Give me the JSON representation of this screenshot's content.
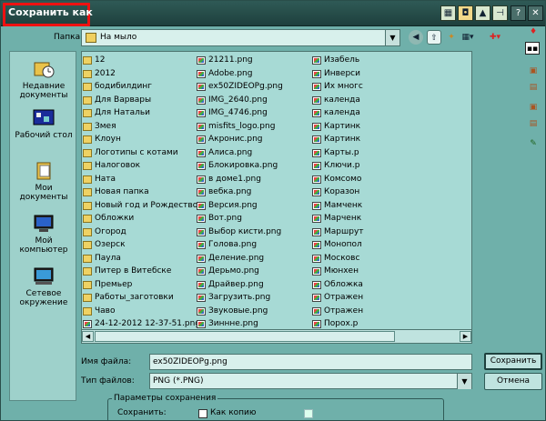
{
  "window": {
    "title": "Сохранить как"
  },
  "toolbar": {
    "folder_label": "Папка:",
    "folder_value": "На мыло"
  },
  "places": [
    {
      "label": "Недавние документы",
      "icon": "recent-docs-icon"
    },
    {
      "label": "Рабочий стол",
      "icon": "desktop-icon"
    },
    {
      "label": "Мои документы",
      "icon": "my-documents-icon"
    },
    {
      "label": "Мой компьютер",
      "icon": "my-computer-icon"
    },
    {
      "label": "Сетевое окружение",
      "icon": "network-icon"
    }
  ],
  "files": {
    "col1": [
      {
        "n": "12",
        "t": "folder"
      },
      {
        "n": "2012",
        "t": "folder"
      },
      {
        "n": "бодибилдинг",
        "t": "folder"
      },
      {
        "n": "Для Варвары",
        "t": "folder"
      },
      {
        "n": "Для Натальи",
        "t": "folder"
      },
      {
        "n": "Змея",
        "t": "folder"
      },
      {
        "n": "Клоун",
        "t": "folder"
      },
      {
        "n": "Логотипы с котами",
        "t": "folder"
      },
      {
        "n": "Налоговок",
        "t": "folder"
      },
      {
        "n": "Ната",
        "t": "folder"
      },
      {
        "n": "Новая папка",
        "t": "folder"
      },
      {
        "n": "Новый год и Рождество",
        "t": "folder"
      },
      {
        "n": "Обложки",
        "t": "folder"
      },
      {
        "n": "Огород",
        "t": "folder"
      },
      {
        "n": "Озерск",
        "t": "folder"
      },
      {
        "n": "Паула",
        "t": "folder"
      },
      {
        "n": "Питер в Витебске",
        "t": "folder"
      },
      {
        "n": "Премьер",
        "t": "folder"
      },
      {
        "n": "Работы_заготовки",
        "t": "folder"
      },
      {
        "n": "Чаво",
        "t": "folder"
      },
      {
        "n": "24-12-2012 12-37-51.png",
        "t": "img"
      }
    ],
    "col2": [
      {
        "n": "21211.png",
        "t": "img"
      },
      {
        "n": "Adobe.png",
        "t": "img"
      },
      {
        "n": "ex50ZIDEOPg.png",
        "t": "img"
      },
      {
        "n": "IMG_2640.png",
        "t": "img"
      },
      {
        "n": "IMG_4746.png",
        "t": "img"
      },
      {
        "n": "misfits_logo.png",
        "t": "img"
      },
      {
        "n": "Акронис.png",
        "t": "img"
      },
      {
        "n": "Алиса.png",
        "t": "img"
      },
      {
        "n": "Блокировка.png",
        "t": "img"
      },
      {
        "n": "в доме1.png",
        "t": "img"
      },
      {
        "n": "вебка.png",
        "t": "img"
      },
      {
        "n": "Версия.png",
        "t": "img"
      },
      {
        "n": "Вот.png",
        "t": "img"
      },
      {
        "n": "Выбор кисти.png",
        "t": "img"
      },
      {
        "n": "Голова.png",
        "t": "img"
      },
      {
        "n": "Деление.png",
        "t": "img"
      },
      {
        "n": "Дерьмо.png",
        "t": "img"
      },
      {
        "n": "Драйвер.png",
        "t": "img"
      },
      {
        "n": "Загрузить.png",
        "t": "img"
      },
      {
        "n": "Звуковые.png",
        "t": "img"
      },
      {
        "n": "Зиннне.png",
        "t": "img"
      }
    ],
    "col3": [
      {
        "n": "Изабель",
        "t": "img"
      },
      {
        "n": "Инверси",
        "t": "img"
      },
      {
        "n": "Их многс",
        "t": "img"
      },
      {
        "n": "календа",
        "t": "img"
      },
      {
        "n": "календа",
        "t": "img"
      },
      {
        "n": "Картинк",
        "t": "img"
      },
      {
        "n": "Картинк",
        "t": "img"
      },
      {
        "n": "Карты.p",
        "t": "img"
      },
      {
        "n": "Ключи.p",
        "t": "img"
      },
      {
        "n": "Комсомо",
        "t": "img"
      },
      {
        "n": "Коразон",
        "t": "img"
      },
      {
        "n": "Мамченк",
        "t": "img"
      },
      {
        "n": "Марченк",
        "t": "img"
      },
      {
        "n": "Маршрут",
        "t": "img"
      },
      {
        "n": "Монопол",
        "t": "img"
      },
      {
        "n": "Московс",
        "t": "img"
      },
      {
        "n": "Мюнхен",
        "t": "img"
      },
      {
        "n": "Обложка",
        "t": "img"
      },
      {
        "n": "Отражен",
        "t": "img"
      },
      {
        "n": "Отражен",
        "t": "img"
      },
      {
        "n": "Порох.р",
        "t": "img"
      }
    ]
  },
  "filename": {
    "label": "Имя файла:",
    "value": "ex50ZIDEOPg.png"
  },
  "filetype": {
    "label": "Тип файлов:",
    "value": "PNG (*.PNG)"
  },
  "buttons": {
    "save": "Сохранить",
    "cancel": "Отмена"
  },
  "save_options": {
    "title": "Параметры сохранения",
    "save_label": "Сохранить:",
    "as_copy": "Как копию"
  }
}
